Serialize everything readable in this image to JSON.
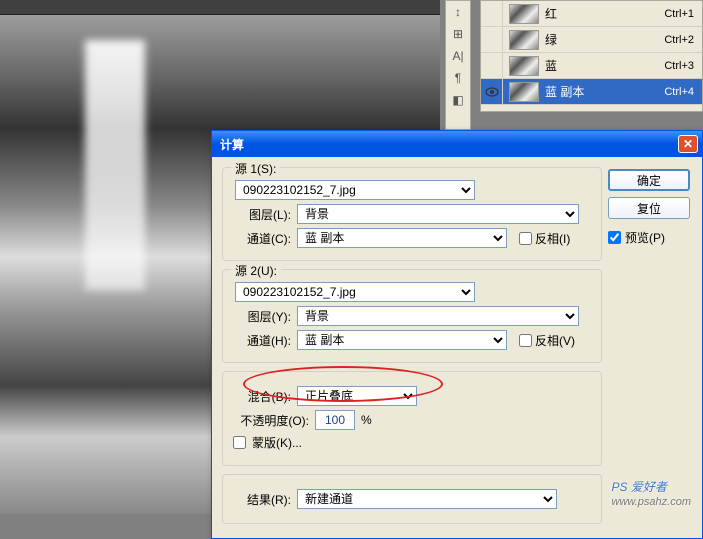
{
  "channels": {
    "items": [
      {
        "name": "红",
        "shortcut": "Ctrl+1",
        "eye": false
      },
      {
        "name": "绿",
        "shortcut": "Ctrl+2",
        "eye": false
      },
      {
        "name": "蓝",
        "shortcut": "Ctrl+3",
        "eye": false
      },
      {
        "name": "蓝 副本",
        "shortcut": "Ctrl+4",
        "eye": true,
        "selected": true
      }
    ]
  },
  "dialog": {
    "title": "计算",
    "ok": "确定",
    "reset": "复位",
    "preview_label": "预览(P)",
    "preview_checked": true,
    "source1": {
      "legend": "源 1(S):",
      "file": "090223102152_7.jpg",
      "layer_label": "图层(L):",
      "layer": "背景",
      "channel_label": "通道(C):",
      "channel": "蓝 副本",
      "invert_label": "反相(I)",
      "invert": false
    },
    "source2": {
      "legend": "源 2(U):",
      "file": "090223102152_7.jpg",
      "layer_label": "图层(Y):",
      "layer": "背景",
      "channel_label": "通道(H):",
      "channel": "蓝 副本",
      "invert_label": "反相(V)",
      "invert": false
    },
    "blend": {
      "label": "混合(B):",
      "value": "正片叠底",
      "opacity_label": "不透明度(O):",
      "opacity": "100",
      "percent": "%",
      "mask_label": "蒙版(K)...",
      "mask_checked": false
    },
    "result": {
      "label": "结果(R):",
      "value": "新建通道"
    }
  },
  "watermark": {
    "main": "PS 爱好者",
    "sub": "www.psahz.com"
  }
}
